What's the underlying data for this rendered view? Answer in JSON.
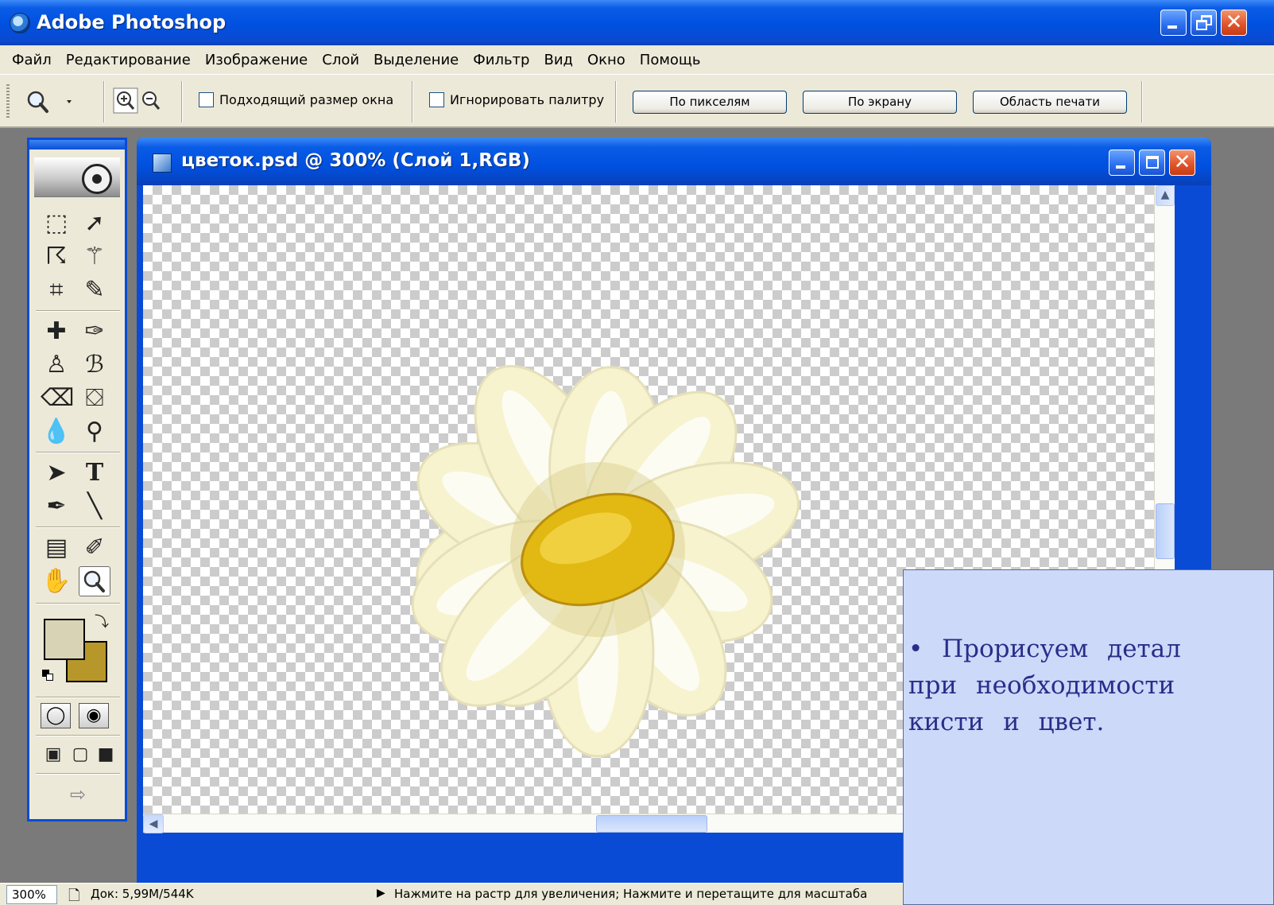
{
  "app": {
    "title": "Adobe Photoshop",
    "accent": "#0a4bd6"
  },
  "menu": [
    "Файл",
    "Редактирование",
    "Изображение",
    "Слой",
    "Выделение",
    "Фильтр",
    "Вид",
    "Окно",
    "Помощь"
  ],
  "options": {
    "tool_icon": "zoom-icon",
    "fit_window_label": "Подходящий размер окна",
    "ignore_palette_label": "Игнорировать палитру",
    "buttons": [
      "По пикселям",
      "По экрану",
      "Область печати"
    ]
  },
  "toolbox": {
    "tools": [
      [
        "marquee-icon",
        "move-icon"
      ],
      [
        "lasso-icon",
        "magic-wand-icon"
      ],
      [
        "crop-icon",
        "slice-icon"
      ],
      [
        "healing-brush-icon",
        "brush-icon"
      ],
      [
        "clone-stamp-icon",
        "history-brush-icon"
      ],
      [
        "eraser-icon",
        "paint-bucket-icon"
      ],
      [
        "blur-icon",
        "dodge-icon"
      ],
      [
        "path-selection-icon",
        "type-icon"
      ],
      [
        "pen-icon",
        "line-icon"
      ],
      [
        "notes-icon",
        "eyedropper-icon"
      ],
      [
        "hand-icon",
        "zoom-icon"
      ]
    ],
    "selected_tool": "zoom-icon",
    "foreground_color": "#d9d3b6",
    "background_color": "#b8972a"
  },
  "document": {
    "title": "цветок.psd @ 300% (Слой 1,RGB)",
    "petal_color": "#f7f3cf",
    "center_color": "#e2b812"
  },
  "status": {
    "zoom": "300%",
    "doc_size": "Док: 5,99M/544K",
    "hint": "Нажмите на растр для увеличения; Нажмите и перетащите для масштаба"
  },
  "slide": {
    "lines": [
      "• Прорисуем детал",
      "при необходимости",
      "кисти и цвет."
    ]
  }
}
